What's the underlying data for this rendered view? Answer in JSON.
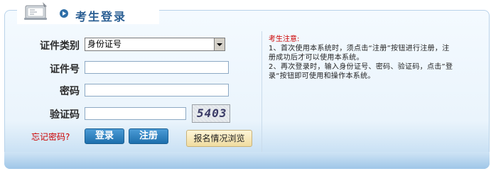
{
  "header": {
    "title": "考生登录"
  },
  "form": {
    "id_type_label": "证件类别",
    "id_type_selected": "身份证号",
    "id_number_label": "证件号",
    "id_number_value": "",
    "password_label": "密码",
    "password_value": "",
    "captcha_label": "验证码",
    "captcha_value": "",
    "captcha_image_text": "5403"
  },
  "actions": {
    "forgot_password": "忘记密码?",
    "login": "登录",
    "register": "注册",
    "browse_status": "报名情况浏览"
  },
  "notice": {
    "title": "考生注意:",
    "lines": [
      "1、首次使用本系统时，须点击“注册”按钮进行注册，注",
      "册成功后才可以使用本系统。",
      "2、再次登录时，输入身份证号、密码、验证码，点击”登",
      "录“按钮即可使用和操作本系统。"
    ]
  },
  "icons": {
    "header_icon": "monitor-icon",
    "title_bullet": "arrow-circle-icon",
    "select_arrow": "chevron-down-icon"
  },
  "colors": {
    "title": "#2a5e93",
    "accent_button": "#1d6fad",
    "warning_red": "#cc0000",
    "panel_border": "#b9d3ea"
  }
}
